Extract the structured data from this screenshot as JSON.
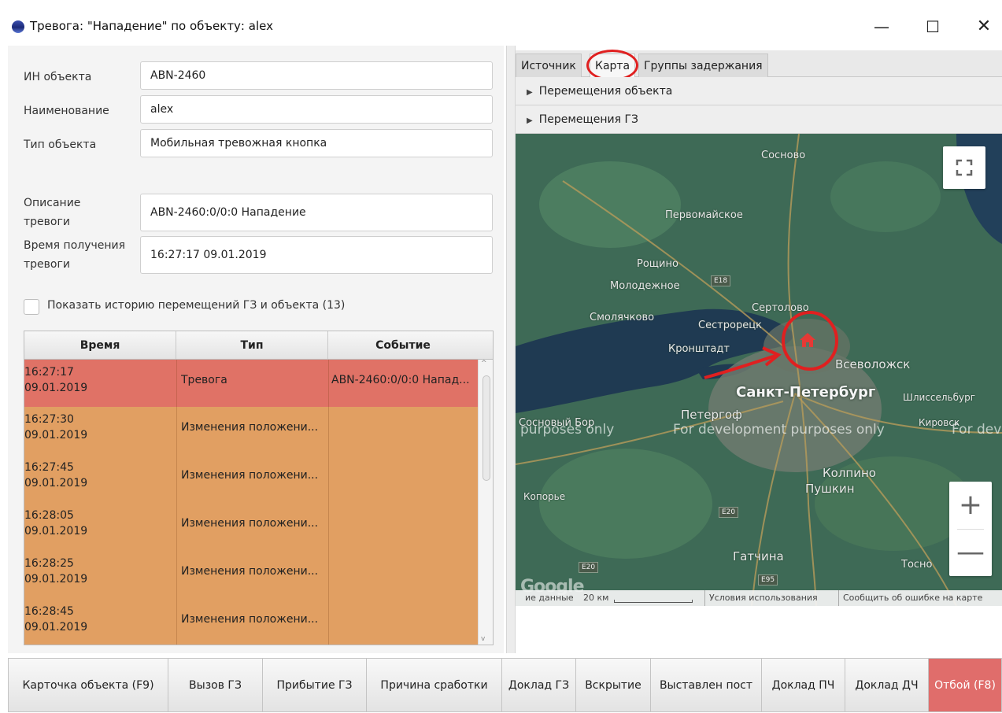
{
  "window": {
    "title": "Тревога: \"Нападение\" по объекту:  alex",
    "minimize": "—",
    "maximize": "☐",
    "close": "✕"
  },
  "form": {
    "id_label": "ИН объекта",
    "id_value": "ABN-2460",
    "name_label": "Наименование",
    "name_value": "alex",
    "type_label": "Тип объекта",
    "type_value": "Мобильная тревожная кнопка",
    "desc_label_1": "Описание",
    "desc_label_2": "тревоги",
    "desc_value": "ABN-2460:0/0:0 Нападение",
    "time_label_1": "Время получения",
    "time_label_2": "тревоги",
    "time_value": "16:27:17 09.01.2019",
    "history_checkbox_label": "Показать историю перемещений ГЗ и объекта (13)",
    "history_checked": false
  },
  "table": {
    "columns": [
      "Время",
      "Тип",
      "Событие"
    ],
    "rows": [
      {
        "time": "16:27:17",
        "date": "09.01.2019",
        "type": "Тревога",
        "event": "ABN-2460:0/0:0 Напад...",
        "color": "#e07266"
      },
      {
        "time": "16:27:30",
        "date": "09.01.2019",
        "type": "Изменения положени...",
        "event": "",
        "color": "#e19f62"
      },
      {
        "time": "16:27:45",
        "date": "09.01.2019",
        "type": "Изменения положени...",
        "event": "",
        "color": "#e19f62"
      },
      {
        "time": "16:28:05",
        "date": "09.01.2019",
        "type": "Изменения положени...",
        "event": "",
        "color": "#e19f62"
      },
      {
        "time": "16:28:25",
        "date": "09.01.2019",
        "type": "Изменения положени...",
        "event": "",
        "color": "#e19f62"
      },
      {
        "time": "16:28:45",
        "date": "09.01.2019",
        "type": "Изменения положени...",
        "event": "",
        "color": "#e19f62"
      }
    ]
  },
  "tabs": [
    {
      "label": "Источник",
      "active": false
    },
    {
      "label": "Карта",
      "active": true
    },
    {
      "label": "Группы задержания",
      "active": false
    }
  ],
  "accordions": {
    "object_moves": "Перемещения объекта",
    "gz_moves": "Перемещения ГЗ"
  },
  "map": {
    "places": {
      "sosnovo": "Сосново",
      "pervomayskoe": "Первомайское",
      "roshchino": "Рощино",
      "molodezhnoe": "Молодежное",
      "smolyachkovo": "Смолячково",
      "sertolovo": "Сертолово",
      "sestroretsk": "Сестрорецк",
      "kronshtadt": "Кронштадт",
      "vsevolozhsk": "Всеволожск",
      "spb": "Санкт-Петербург",
      "shlisselburg": "Шлиссельбург",
      "sosnovy_bor": "Сосновый Бор",
      "peterhof": "Петергоф",
      "kirovsk": "Кировск",
      "kolpino": "Колпино",
      "pushkin": "Пушкин",
      "koporye": "Копорье",
      "gatchina": "Гатчина",
      "tosno": "Тосно"
    },
    "roads": {
      "e18": "E18",
      "e20a": "E20",
      "e20b": "E20",
      "e95": "E95"
    },
    "watermark": [
      "purposes only",
      "For development purposes only",
      "For dev"
    ],
    "google": "Google",
    "footer": {
      "map_data": "ие данные",
      "scale": "20 км",
      "terms": "Условия использования",
      "report": "Сообщить об ошибке на карте"
    },
    "zoom_in": "+",
    "zoom_out": "—",
    "accent_marker": "#e02020"
  },
  "buttons": [
    {
      "label": "Карточка объекта (F9)"
    },
    {
      "label": "Вызов ГЗ"
    },
    {
      "label": "Прибытие ГЗ"
    },
    {
      "label": "Причина сработки"
    },
    {
      "label": "Доклад ГЗ"
    },
    {
      "label": "Вскрытие"
    },
    {
      "label": "Выставлен пост"
    },
    {
      "label": "Доклад ПЧ"
    },
    {
      "label": "Доклад ДЧ"
    },
    {
      "label": "Отбой (F8)"
    }
  ]
}
